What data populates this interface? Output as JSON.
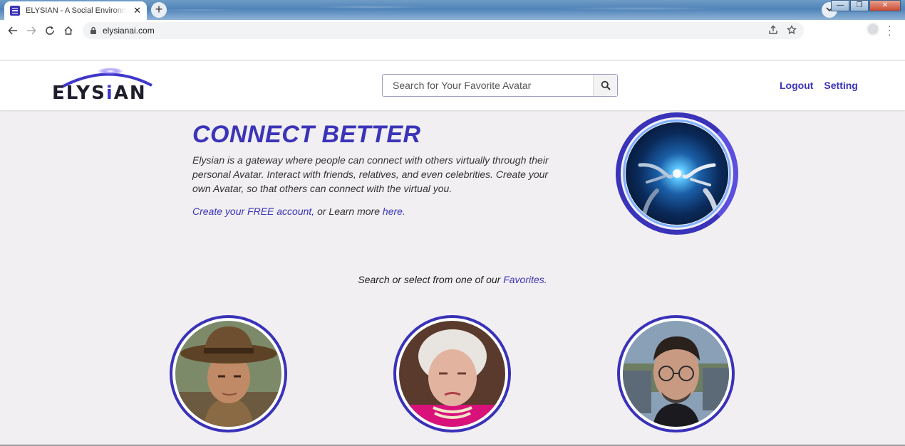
{
  "browser": {
    "tab_title": "ELYSIAN - A Social Environment C",
    "tab_close": "✕",
    "new_tab": "+",
    "url": "elysianai.com",
    "window_buttons": [
      "—",
      "❐",
      "✕"
    ]
  },
  "header": {
    "logo_text_part1": "ELYS",
    "logo_text_accent": "i",
    "logo_text_part2": "AN",
    "search_placeholder": "Search for Your Favorite Avatar",
    "nav": [
      {
        "label": "Logout"
      },
      {
        "label": "Setting"
      }
    ]
  },
  "hero": {
    "title": "CONNECT BETTER",
    "description": "Elysian is a gateway where people can connect with others virtually through their personal Avatar. Interact with friends, relatives, and even celebrities. Create your own Avatar, so that others can connect with the virtual you.",
    "cta_link": "Create your FREE account,",
    "cta_middle": " or Learn more ",
    "cta_here": "here",
    "cta_end": "."
  },
  "favorites": {
    "prefix": "Search or select from one of our ",
    "link": "Favorites",
    "suffix": "."
  },
  "colors": {
    "accent": "#3b34b8",
    "page_bg": "#f1eff2"
  }
}
